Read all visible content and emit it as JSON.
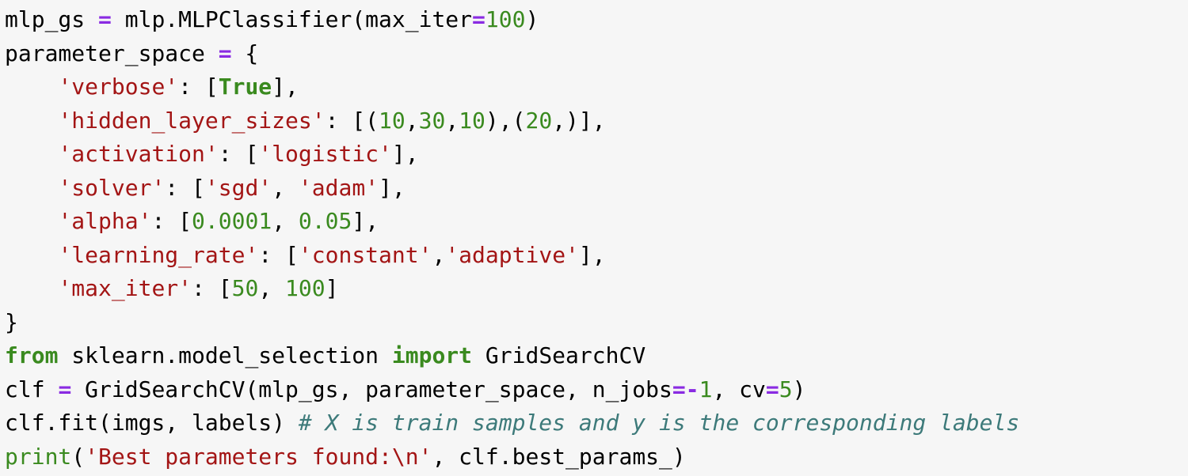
{
  "colors": {
    "background": "#f6f6f6",
    "plain": "#000000",
    "operator": "#8a2be2",
    "number": "#3a8a1f",
    "string": "#a31515",
    "keyword": "#3a8a1f",
    "builtin": "#3a8a1f",
    "comment": "#3d7a7a"
  },
  "code_lines": [
    [
      {
        "t": "plain",
        "v": "mlp_gs "
      },
      {
        "t": "op",
        "v": "="
      },
      {
        "t": "plain",
        "v": " mlp.MLPClassifier(max_iter"
      },
      {
        "t": "op",
        "v": "="
      },
      {
        "t": "num",
        "v": "100"
      },
      {
        "t": "plain",
        "v": ")"
      }
    ],
    [
      {
        "t": "plain",
        "v": "parameter_space "
      },
      {
        "t": "op",
        "v": "="
      },
      {
        "t": "plain",
        "v": " {"
      }
    ],
    [
      {
        "t": "plain",
        "v": "    "
      },
      {
        "t": "str",
        "v": "'verbose'"
      },
      {
        "t": "plain",
        "v": ": ["
      },
      {
        "t": "kw",
        "v": "True"
      },
      {
        "t": "plain",
        "v": "],"
      }
    ],
    [
      {
        "t": "plain",
        "v": "    "
      },
      {
        "t": "str",
        "v": "'hidden_layer_sizes'"
      },
      {
        "t": "plain",
        "v": ": [("
      },
      {
        "t": "num",
        "v": "10"
      },
      {
        "t": "plain",
        "v": ","
      },
      {
        "t": "num",
        "v": "30"
      },
      {
        "t": "plain",
        "v": ","
      },
      {
        "t": "num",
        "v": "10"
      },
      {
        "t": "plain",
        "v": "),("
      },
      {
        "t": "num",
        "v": "20"
      },
      {
        "t": "plain",
        "v": ",)],"
      }
    ],
    [
      {
        "t": "plain",
        "v": "    "
      },
      {
        "t": "str",
        "v": "'activation'"
      },
      {
        "t": "plain",
        "v": ": ["
      },
      {
        "t": "str",
        "v": "'logistic'"
      },
      {
        "t": "plain",
        "v": "],"
      }
    ],
    [
      {
        "t": "plain",
        "v": "    "
      },
      {
        "t": "str",
        "v": "'solver'"
      },
      {
        "t": "plain",
        "v": ": ["
      },
      {
        "t": "str",
        "v": "'sgd'"
      },
      {
        "t": "plain",
        "v": ", "
      },
      {
        "t": "str",
        "v": "'adam'"
      },
      {
        "t": "plain",
        "v": "],"
      }
    ],
    [
      {
        "t": "plain",
        "v": "    "
      },
      {
        "t": "str",
        "v": "'alpha'"
      },
      {
        "t": "plain",
        "v": ": ["
      },
      {
        "t": "num",
        "v": "0.0001"
      },
      {
        "t": "plain",
        "v": ", "
      },
      {
        "t": "num",
        "v": "0.05"
      },
      {
        "t": "plain",
        "v": "],"
      }
    ],
    [
      {
        "t": "plain",
        "v": "    "
      },
      {
        "t": "str",
        "v": "'learning_rate'"
      },
      {
        "t": "plain",
        "v": ": ["
      },
      {
        "t": "str",
        "v": "'constant'"
      },
      {
        "t": "plain",
        "v": ","
      },
      {
        "t": "str",
        "v": "'adaptive'"
      },
      {
        "t": "plain",
        "v": "],"
      }
    ],
    [
      {
        "t": "plain",
        "v": "    "
      },
      {
        "t": "str",
        "v": "'max_iter'"
      },
      {
        "t": "plain",
        "v": ": ["
      },
      {
        "t": "num",
        "v": "50"
      },
      {
        "t": "plain",
        "v": ", "
      },
      {
        "t": "num",
        "v": "100"
      },
      {
        "t": "plain",
        "v": "]"
      }
    ],
    [
      {
        "t": "plain",
        "v": "}"
      }
    ],
    [
      {
        "t": "kw",
        "v": "from"
      },
      {
        "t": "plain",
        "v": " sklearn.model_selection "
      },
      {
        "t": "kw",
        "v": "import"
      },
      {
        "t": "plain",
        "v": " GridSearchCV"
      }
    ],
    [
      {
        "t": "plain",
        "v": "clf "
      },
      {
        "t": "op",
        "v": "="
      },
      {
        "t": "plain",
        "v": " GridSearchCV(mlp_gs, parameter_space, n_jobs"
      },
      {
        "t": "op",
        "v": "=-"
      },
      {
        "t": "num",
        "v": "1"
      },
      {
        "t": "plain",
        "v": ", cv"
      },
      {
        "t": "op",
        "v": "="
      },
      {
        "t": "num",
        "v": "5"
      },
      {
        "t": "plain",
        "v": ")"
      }
    ],
    [
      {
        "t": "plain",
        "v": "clf.fit(imgs, labels) "
      },
      {
        "t": "comment",
        "v": "# X is train samples and y is the corresponding labels"
      }
    ],
    [
      {
        "t": "builtin",
        "v": "print"
      },
      {
        "t": "plain",
        "v": "("
      },
      {
        "t": "str",
        "v": "'Best parameters found:\\n'"
      },
      {
        "t": "plain",
        "v": ", clf.best_params_)"
      }
    ]
  ]
}
